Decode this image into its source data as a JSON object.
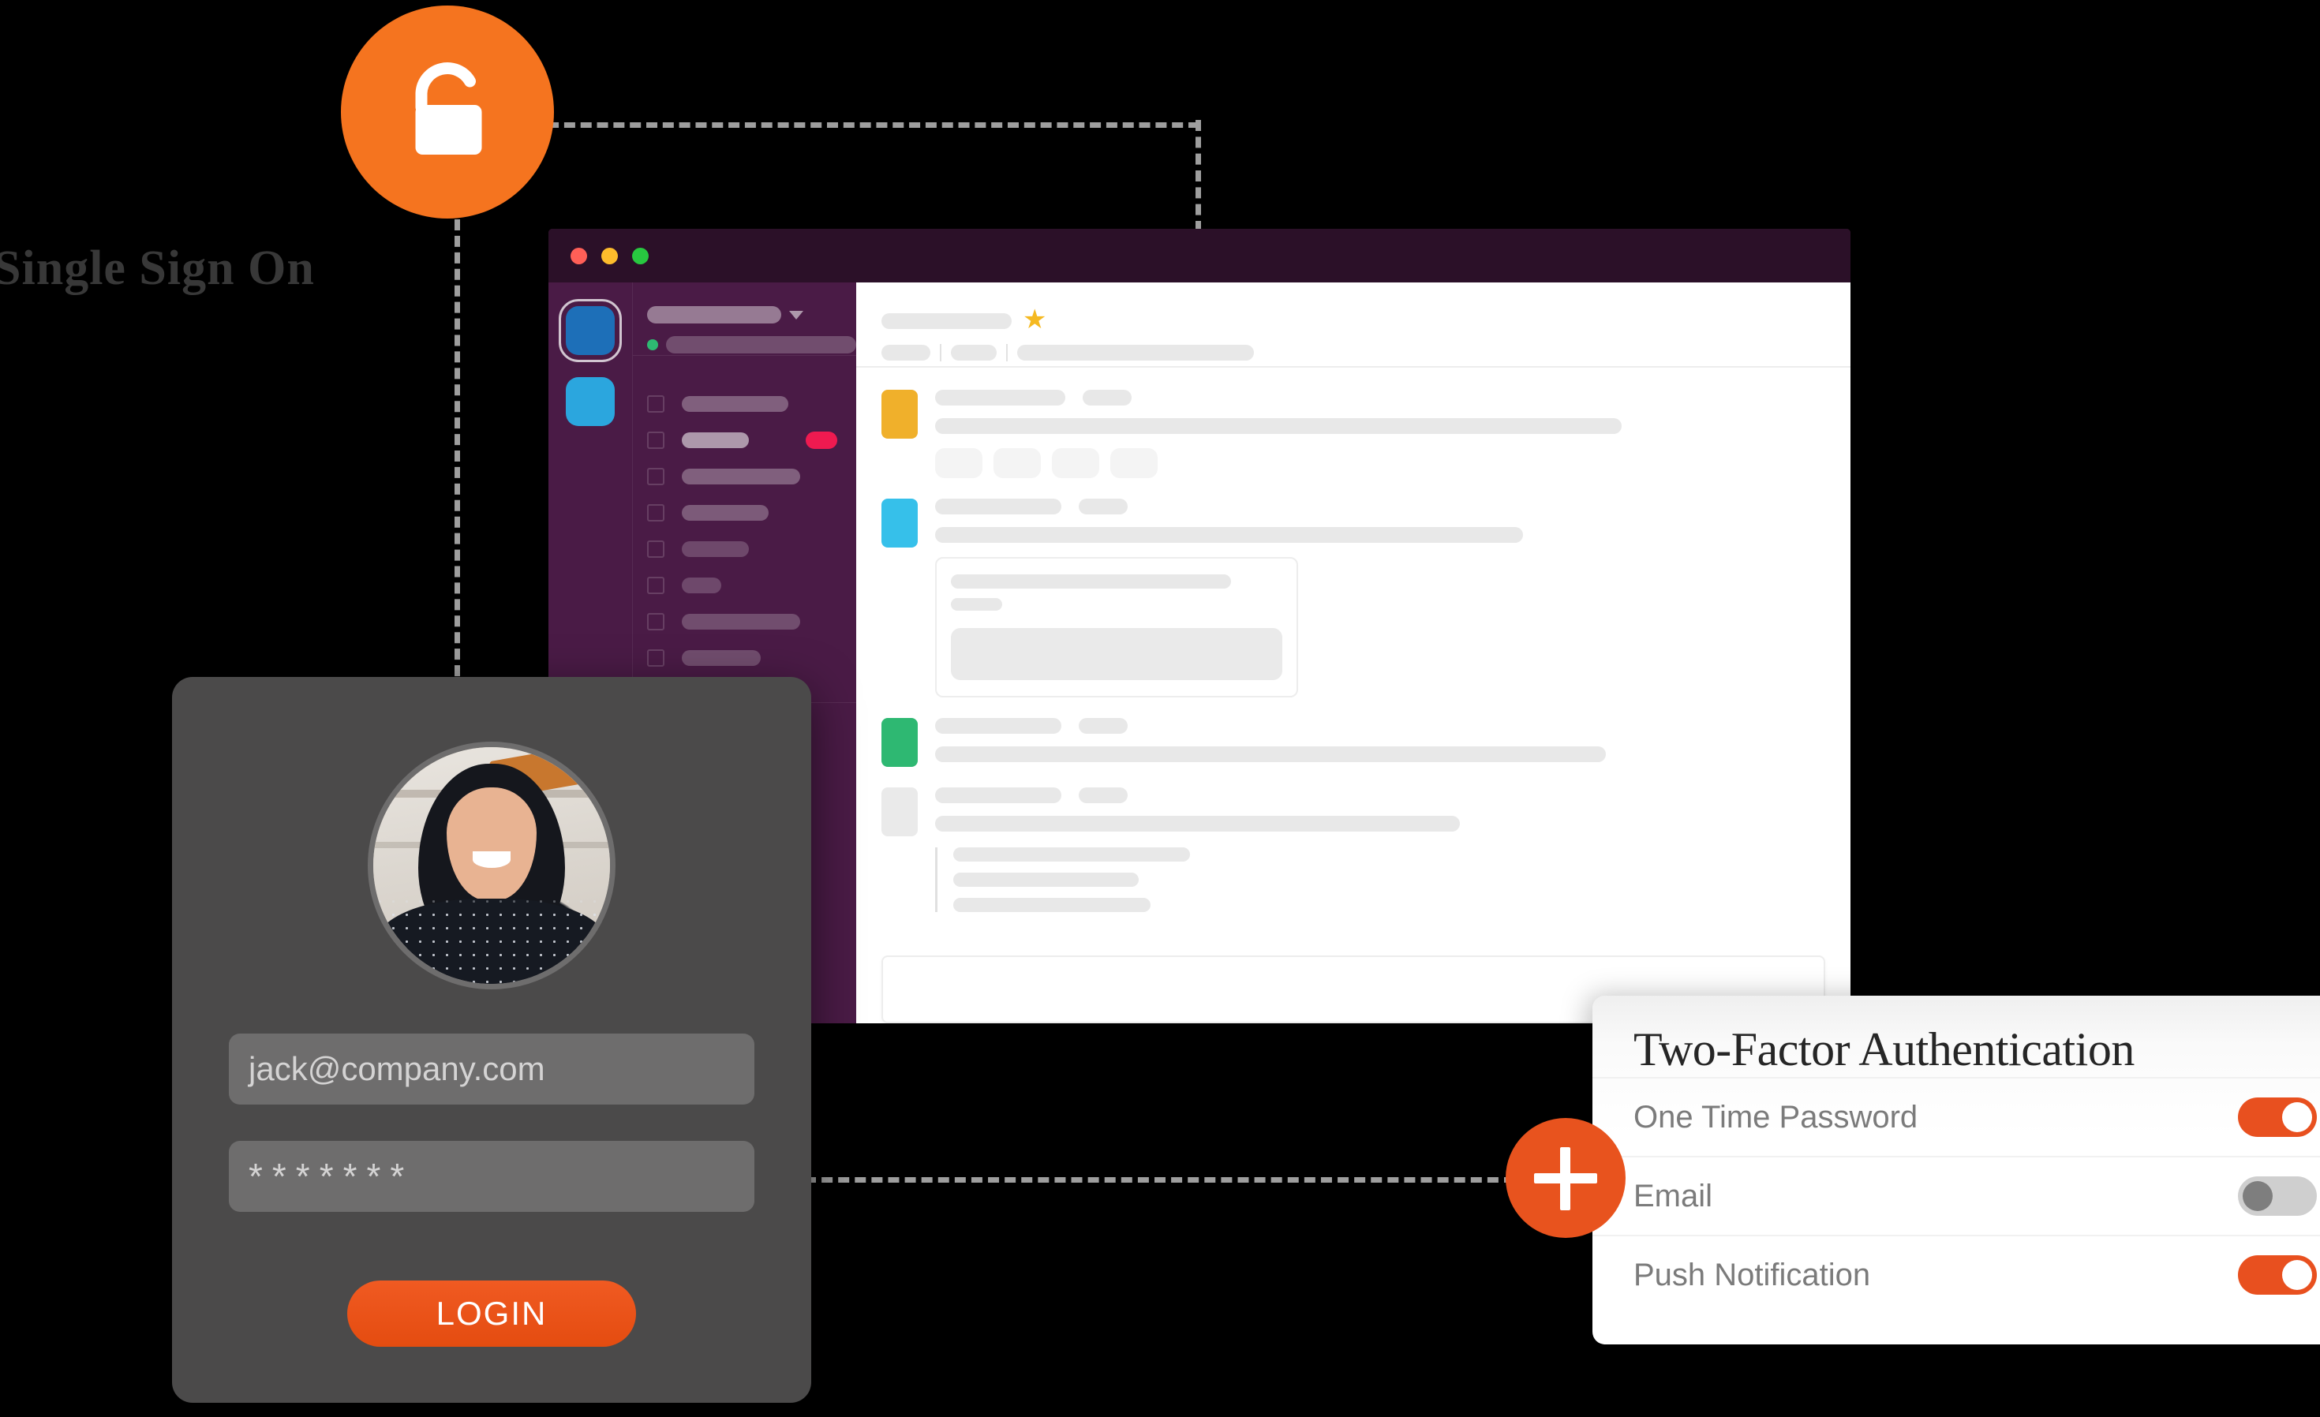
{
  "labels": {
    "sso_heading": "Single Sign On"
  },
  "icons": {
    "lock": "unlocked-padlock-icon",
    "plus": "plus-icon",
    "star": "★",
    "caret": "chevron-down-icon"
  },
  "colors": {
    "accent_orange": "#F5741F",
    "button_orange": "#E8531E",
    "toggle_on": "#E8501F",
    "toggle_off": "#CFCFCF",
    "sidebar_purple": "#4A1B46",
    "titlebar_purple": "#2B1028",
    "badge_pink": "#EF1A50",
    "star_yellow": "#F5B921",
    "card_gray": "#4B4A4A",
    "dash_gray": "#9E9E9E"
  },
  "browser": {
    "traffic_lights": [
      "close",
      "minimize",
      "zoom"
    ],
    "rail_tiles": [
      {
        "name": "workspace-tile-1",
        "color": "#1D6FB8",
        "selected": true
      },
      {
        "name": "workspace-tile-2",
        "color": "#2BA6DE",
        "selected": false
      }
    ],
    "channel_rows": [
      {
        "width": 135,
        "opacity": 0.3,
        "badge": false
      },
      {
        "width": 85,
        "opacity": 0.55,
        "badge": true
      },
      {
        "width": 150,
        "opacity": 0.3,
        "badge": false
      },
      {
        "width": 110,
        "opacity": 0.28,
        "badge": false
      },
      {
        "width": 85,
        "opacity": 0.2,
        "badge": false
      },
      {
        "width": 50,
        "opacity": 0.2,
        "badge": false
      },
      {
        "width": 150,
        "opacity": 0.22,
        "badge": false
      },
      {
        "width": 100,
        "opacity": 0.22,
        "badge": false
      }
    ],
    "channel_rows_lower": [
      {
        "width": 40,
        "opacity": 0.2
      },
      {
        "width": 40,
        "opacity": 0.3
      }
    ],
    "header": {
      "title_bar_width": 165,
      "meta_pills": [
        62,
        58,
        300
      ]
    },
    "messages": [
      {
        "name": "message-row-1",
        "avatar_color": "#F0B02B",
        "line1": [
          165,
          62
        ],
        "line2": 870,
        "reactions": 4,
        "attachment": false,
        "quote": false
      },
      {
        "name": "message-row-2",
        "avatar_color": "#36C0EA",
        "line1": [
          160,
          62
        ],
        "line2": 745,
        "reactions": 0,
        "attachment": true,
        "quote": false
      },
      {
        "name": "message-row-3",
        "avatar_color": "#2EB872",
        "line1": [
          160,
          62
        ],
        "line2": 850,
        "reactions": 0,
        "attachment": false,
        "quote": false
      },
      {
        "name": "message-row-4",
        "avatar_color": "#EAEAEA",
        "line1": [
          160,
          62
        ],
        "line2": 665,
        "reactions": 0,
        "attachment": false,
        "quote": true,
        "quote_lines": [
          300,
          235,
          250
        ]
      }
    ],
    "composer_placeholder": ""
  },
  "login": {
    "email_value": "jack@company.com",
    "password_value": "*******",
    "submit_label": "LOGIN",
    "avatar_alt": "user-profile-photo"
  },
  "two_factor": {
    "title": "Two-Factor Authentication",
    "rows": [
      {
        "label": "One Time Password",
        "enabled": true
      },
      {
        "label": "Email",
        "enabled": false
      },
      {
        "label": "Push Notification",
        "enabled": true
      }
    ]
  }
}
